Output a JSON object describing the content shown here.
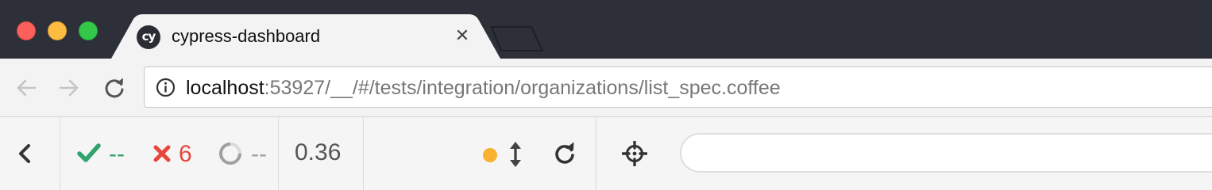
{
  "browser": {
    "tab": {
      "title": "cypress-dashboard",
      "favicon_text": "cy",
      "close_glyph": "✕"
    },
    "traffic_lights": [
      "close",
      "minimize",
      "maximize"
    ],
    "address": {
      "host": "localhost",
      "rest": ":53927/__/#/tests/integration/organizations/list_spec.coffee",
      "icon": "info-icon"
    },
    "nav_icons": [
      "back-arrow-icon",
      "forward-arrow-icon",
      "reload-icon"
    ]
  },
  "runner": {
    "passed": "--",
    "failed": "6",
    "pending": "--",
    "duration": "0.36",
    "colors": {
      "passed": "#31a36d",
      "failed": "#e8453c",
      "pending": "#a0a0a0",
      "running_dot": "#f8b130",
      "text": "#555555"
    },
    "icons": [
      "chevron-left-icon",
      "check-icon",
      "x-icon",
      "spinner-icon",
      "status-dot-icon",
      "resize-arrows-icon",
      "rerun-icon",
      "crosshair-icon"
    ],
    "search": {
      "value": "",
      "placeholder": ""
    }
  }
}
